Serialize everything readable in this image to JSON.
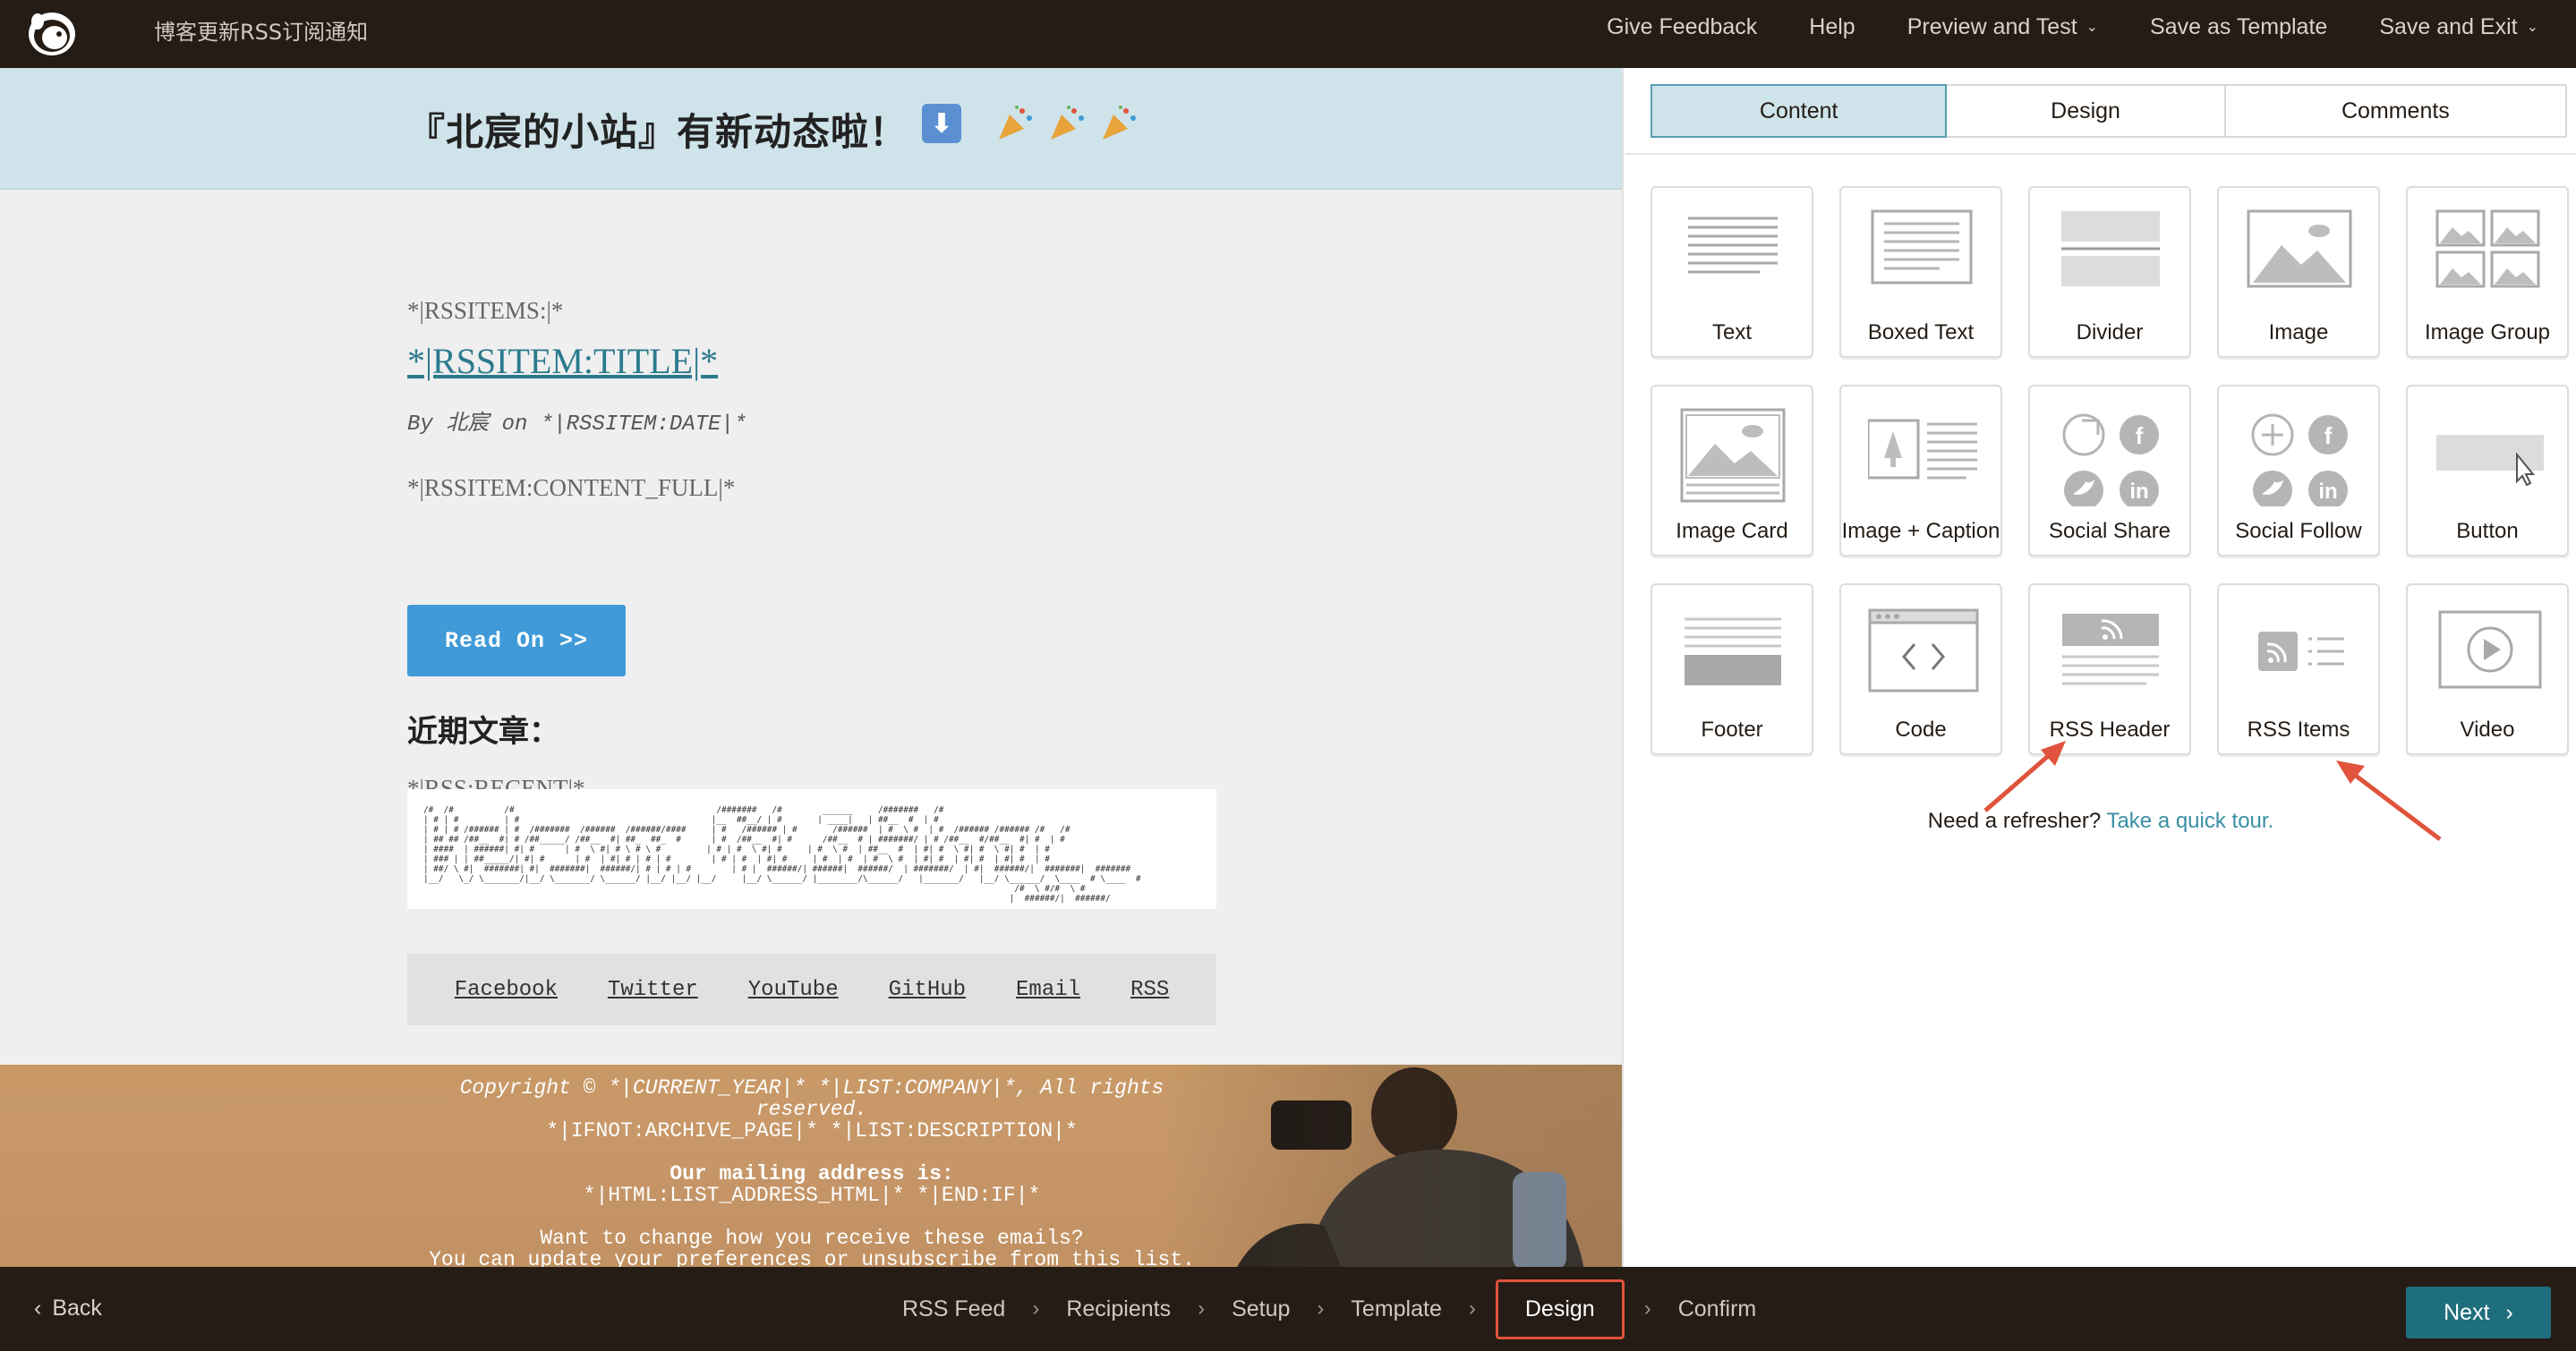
{
  "app": {
    "title": "博客更新RSS订阅通知"
  },
  "topnav": {
    "give_feedback": "Give Feedback",
    "help": "Help",
    "preview_and_test": "Preview and Test",
    "save_as_template": "Save as Template",
    "save_and_exit": "Save and Exit"
  },
  "email": {
    "header_text": "『北宸的小站』有新动态啦！",
    "rss_items_tag": "*|RSSITEMS:|*",
    "rss_item_title": "*|RSSITEM:TITLE|*",
    "rss_item_meta": "By 北宸 on *|RSSITEM:DATE|*",
    "rss_item_content": "*|RSSITEM:CONTENT_FULL|*",
    "read_on_button": "Read On >>",
    "recent_heading": "近期文章：",
    "recent_tag": "*|RSS:RECENT|*",
    "social_links": [
      "Facebook",
      "Twitter",
      "YouTube",
      "GitHub",
      "Email",
      "RSS"
    ],
    "footer": {
      "copyright_line1": "Copyright © *|CURRENT_YEAR|* *|LIST:COMPANY|*, All rights",
      "copyright_line2": "reserved.",
      "archive_line": "*|IFNOT:ARCHIVE_PAGE|* *|LIST:DESCRIPTION|*",
      "mailing_heading": "Our mailing address is:",
      "address_line": "*|HTML:LIST_ADDRESS_HTML|* *|END:IF|*",
      "change_line": "Want to change how you receive these emails?",
      "update_line": "You can update your preferences or unsubscribe from this list."
    }
  },
  "panel": {
    "tabs": [
      "Content",
      "Design",
      "Comments"
    ],
    "active_tab": "Content",
    "blocks": [
      "Text",
      "Boxed Text",
      "Divider",
      "Image",
      "Image Group",
      "Image Card",
      "Image + Caption",
      "Social Share",
      "Social Follow",
      "Button",
      "Footer",
      "Code",
      "RSS Header",
      "RSS Items",
      "Video"
    ],
    "refresher_text": "Need a refresher?",
    "refresher_link": "Take a quick tour."
  },
  "bottombar": {
    "back": "Back",
    "steps": [
      "RSS Feed",
      "Recipients",
      "Setup",
      "Template",
      "Design",
      "Confirm"
    ],
    "current_step": "Design",
    "next": "Next"
  },
  "colors": {
    "topbar": "#241c15",
    "header_banner": "#cfe3ea",
    "read_on_button": "#3f9ad7",
    "link": "#2b7a8c",
    "next_button": "#1f6e7e",
    "annotation_red": "#e0533c"
  }
}
